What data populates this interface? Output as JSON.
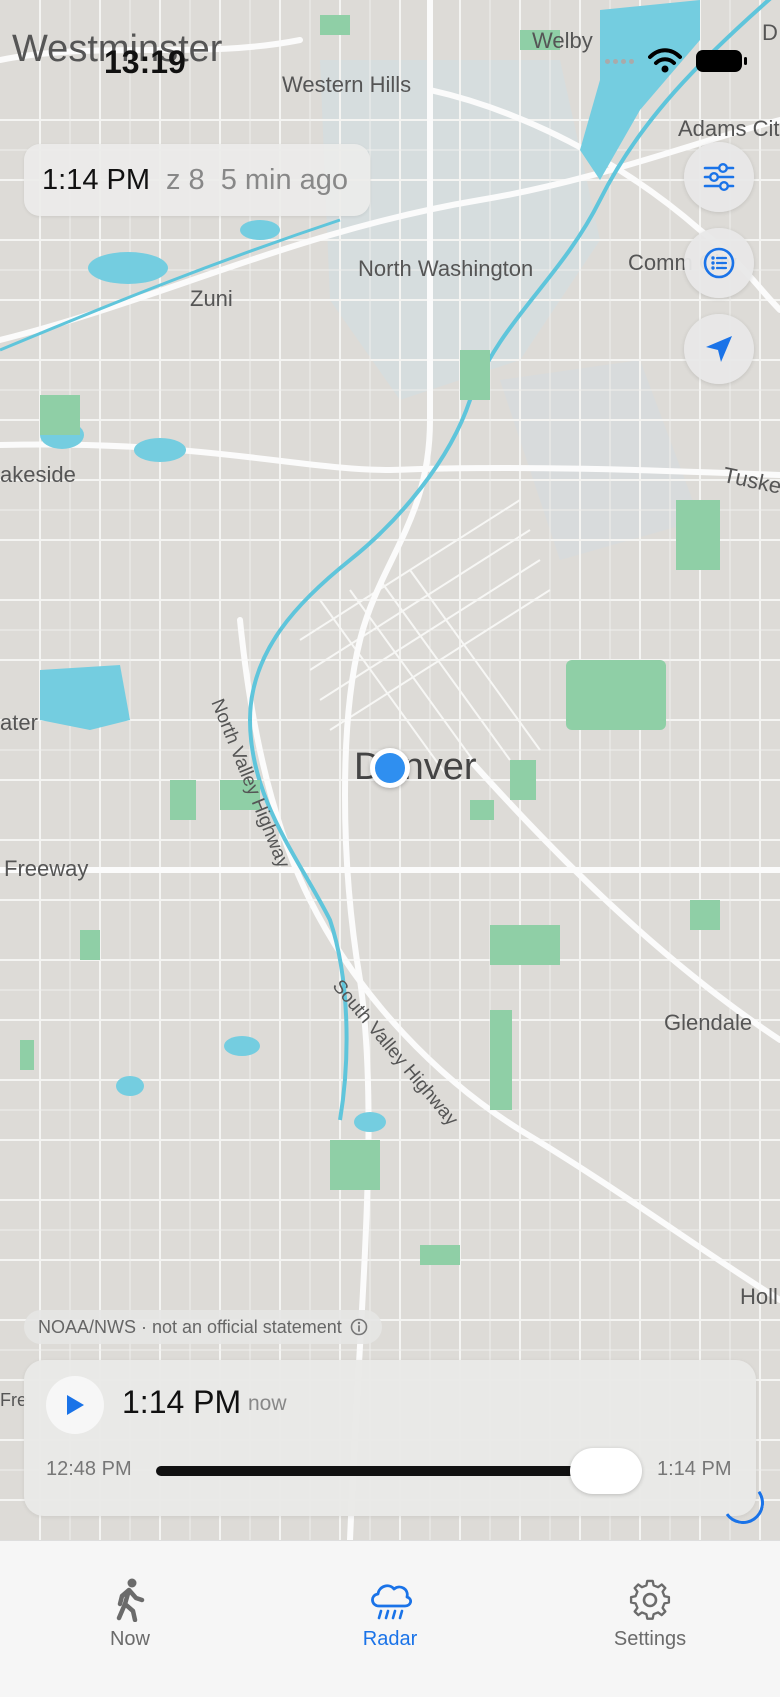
{
  "status_bar": {
    "time": "13:19"
  },
  "map": {
    "labels": [
      {
        "name": "westminster",
        "text": "Westminster"
      },
      {
        "name": "welby",
        "text": "Welby"
      },
      {
        "name": "western-hills",
        "text": "Western Hills"
      },
      {
        "name": "adams-city",
        "text": "Adams Cit"
      },
      {
        "name": "north-washington",
        "text": "North Washington"
      },
      {
        "name": "commerce-city",
        "text": "Comm      City"
      },
      {
        "name": "zuni",
        "text": "Zuni"
      },
      {
        "name": "lakeside",
        "text": "akeside"
      },
      {
        "name": "tuskegee",
        "text": "Tuske"
      },
      {
        "name": "water",
        "text": "ater"
      },
      {
        "name": "denver",
        "text": "Denver"
      },
      {
        "name": "freeway",
        "text": "Freeway"
      },
      {
        "name": "north-valley-hwy",
        "text": "North Valley Highway"
      },
      {
        "name": "south-valley-hwy",
        "text": "South Valley Highway"
      },
      {
        "name": "glendale",
        "text": "Glendale"
      },
      {
        "name": "holly",
        "text": "Holl"
      },
      {
        "name": "fre",
        "text": "Fre"
      },
      {
        "name": "d-edge",
        "text": "D"
      }
    ]
  },
  "time_pill": {
    "time": "1:14 PM",
    "zoom": "z 8",
    "ago": "5 min ago"
  },
  "attribution": {
    "text": "NOAA/NWS · not an official statement"
  },
  "player": {
    "time": "1:14 PM",
    "now": "now",
    "range_start": "12:48 PM",
    "range_end": "1:14 PM",
    "progress": 1.0
  },
  "tabs": [
    {
      "label": "Now",
      "icon": "walking-person-icon",
      "active": false
    },
    {
      "label": "Radar",
      "icon": "rain-cloud-icon",
      "active": true
    },
    {
      "label": "Settings",
      "icon": "gear-icon",
      "active": false
    }
  ],
  "colors": {
    "accent": "#1a73e8",
    "water": "#74cde0",
    "park": "#8fcfa6"
  }
}
